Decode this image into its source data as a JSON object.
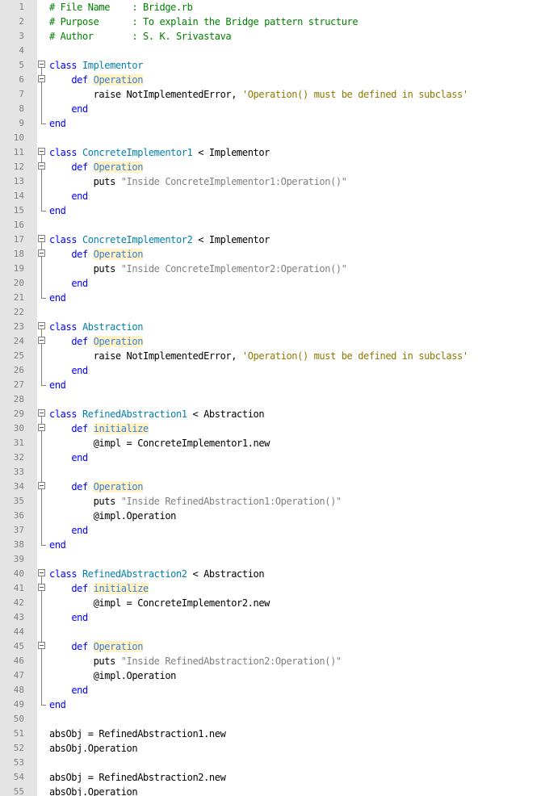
{
  "editor": {
    "lines": [
      {
        "n": "1",
        "fold": "",
        "tokens": [
          {
            "t": "# File Name    : Bridge.rb",
            "c": "comment"
          }
        ]
      },
      {
        "n": "2",
        "fold": "",
        "tokens": [
          {
            "t": "# Purpose      : To explain the Bridge pattern structure",
            "c": "comment"
          }
        ]
      },
      {
        "n": "3",
        "fold": "",
        "tokens": [
          {
            "t": "# Author       : S. K. Srivastava",
            "c": "comment"
          }
        ]
      },
      {
        "n": "4",
        "fold": "",
        "tokens": []
      },
      {
        "n": "5",
        "fold": "minus",
        "tokens": [
          {
            "t": "class",
            "c": "kw"
          },
          {
            "t": " "
          },
          {
            "t": "Implementor",
            "c": "cls"
          }
        ]
      },
      {
        "n": "6",
        "fold": "minus2",
        "tokens": [
          {
            "t": "    "
          },
          {
            "t": "def",
            "c": "kw"
          },
          {
            "t": " "
          },
          {
            "t": "Operation",
            "c": "fn"
          }
        ]
      },
      {
        "n": "7",
        "fold": "bar",
        "tokens": [
          {
            "t": "        raise NotImplementedError, "
          },
          {
            "t": "'Operation() must be defined in subclass'",
            "c": "sq"
          }
        ]
      },
      {
        "n": "8",
        "fold": "bar",
        "tokens": [
          {
            "t": "    "
          },
          {
            "t": "end",
            "c": "kw"
          }
        ]
      },
      {
        "n": "9",
        "fold": "end",
        "tokens": [
          {
            "t": "end",
            "c": "kw"
          }
        ]
      },
      {
        "n": "10",
        "fold": "",
        "tokens": []
      },
      {
        "n": "11",
        "fold": "minus",
        "tokens": [
          {
            "t": "class",
            "c": "kw"
          },
          {
            "t": " "
          },
          {
            "t": "ConcreteImplementor1",
            "c": "cls"
          },
          {
            "t": " < Implementor"
          }
        ]
      },
      {
        "n": "12",
        "fold": "minus2",
        "tokens": [
          {
            "t": "    "
          },
          {
            "t": "def",
            "c": "kw"
          },
          {
            "t": " "
          },
          {
            "t": "Operation",
            "c": "fn"
          }
        ]
      },
      {
        "n": "13",
        "fold": "bar",
        "tokens": [
          {
            "t": "        puts "
          },
          {
            "t": "\"Inside ConcreteImplementor1:Operation()\"",
            "c": "str"
          }
        ]
      },
      {
        "n": "14",
        "fold": "bar",
        "tokens": [
          {
            "t": "    "
          },
          {
            "t": "end",
            "c": "kw"
          }
        ]
      },
      {
        "n": "15",
        "fold": "end",
        "tokens": [
          {
            "t": "end",
            "c": "kw"
          }
        ]
      },
      {
        "n": "16",
        "fold": "",
        "tokens": []
      },
      {
        "n": "17",
        "fold": "minus",
        "tokens": [
          {
            "t": "class",
            "c": "kw"
          },
          {
            "t": " "
          },
          {
            "t": "ConcreteImplementor2",
            "c": "cls"
          },
          {
            "t": " < Implementor"
          }
        ]
      },
      {
        "n": "18",
        "fold": "minus2",
        "tokens": [
          {
            "t": "    "
          },
          {
            "t": "def",
            "c": "kw"
          },
          {
            "t": " "
          },
          {
            "t": "Operation",
            "c": "fn"
          }
        ]
      },
      {
        "n": "19",
        "fold": "bar",
        "tokens": [
          {
            "t": "        puts "
          },
          {
            "t": "\"Inside ConcreteImplementor2:Operation()\"",
            "c": "str"
          }
        ]
      },
      {
        "n": "20",
        "fold": "bar",
        "tokens": [
          {
            "t": "    "
          },
          {
            "t": "end",
            "c": "kw"
          }
        ]
      },
      {
        "n": "21",
        "fold": "end",
        "tokens": [
          {
            "t": "end",
            "c": "kw"
          }
        ]
      },
      {
        "n": "22",
        "fold": "",
        "tokens": []
      },
      {
        "n": "23",
        "fold": "minus",
        "tokens": [
          {
            "t": "class",
            "c": "kw"
          },
          {
            "t": " "
          },
          {
            "t": "Abstraction",
            "c": "cls"
          }
        ]
      },
      {
        "n": "24",
        "fold": "minus2",
        "tokens": [
          {
            "t": "    "
          },
          {
            "t": "def",
            "c": "kw"
          },
          {
            "t": " "
          },
          {
            "t": "Operation",
            "c": "fn"
          }
        ]
      },
      {
        "n": "25",
        "fold": "bar",
        "tokens": [
          {
            "t": "        raise NotImplementedError, "
          },
          {
            "t": "'Operation() must be defined in subclass'",
            "c": "sq"
          }
        ]
      },
      {
        "n": "26",
        "fold": "bar",
        "tokens": [
          {
            "t": "    "
          },
          {
            "t": "end",
            "c": "kw"
          }
        ]
      },
      {
        "n": "27",
        "fold": "end",
        "tokens": [
          {
            "t": "end",
            "c": "kw"
          }
        ]
      },
      {
        "n": "28",
        "fold": "",
        "tokens": []
      },
      {
        "n": "29",
        "fold": "minus",
        "tokens": [
          {
            "t": "class",
            "c": "kw"
          },
          {
            "t": " "
          },
          {
            "t": "RefinedAbstraction1",
            "c": "cls"
          },
          {
            "t": " < Abstraction"
          }
        ]
      },
      {
        "n": "30",
        "fold": "minus2",
        "tokens": [
          {
            "t": "    "
          },
          {
            "t": "def",
            "c": "kw"
          },
          {
            "t": " "
          },
          {
            "t": "initialize",
            "c": "fn"
          }
        ]
      },
      {
        "n": "31",
        "fold": "bar",
        "tokens": [
          {
            "t": "        @impl = ConcreteImplementor1.new"
          }
        ]
      },
      {
        "n": "32",
        "fold": "bar",
        "tokens": [
          {
            "t": "    "
          },
          {
            "t": "end",
            "c": "kw"
          }
        ]
      },
      {
        "n": "33",
        "fold": "bar",
        "tokens": []
      },
      {
        "n": "34",
        "fold": "minus2",
        "tokens": [
          {
            "t": "    "
          },
          {
            "t": "def",
            "c": "kw"
          },
          {
            "t": " "
          },
          {
            "t": "Operation",
            "c": "fn"
          }
        ]
      },
      {
        "n": "35",
        "fold": "bar",
        "tokens": [
          {
            "t": "        puts "
          },
          {
            "t": "\"Inside RefinedAbstraction1:Operation()\"",
            "c": "str"
          }
        ]
      },
      {
        "n": "36",
        "fold": "bar",
        "tokens": [
          {
            "t": "        @impl.Operation"
          }
        ]
      },
      {
        "n": "37",
        "fold": "bar",
        "tokens": [
          {
            "t": "    "
          },
          {
            "t": "end",
            "c": "kw"
          }
        ]
      },
      {
        "n": "38",
        "fold": "end",
        "tokens": [
          {
            "t": "end",
            "c": "kw"
          }
        ]
      },
      {
        "n": "39",
        "fold": "",
        "tokens": []
      },
      {
        "n": "40",
        "fold": "minus",
        "tokens": [
          {
            "t": "class",
            "c": "kw"
          },
          {
            "t": " "
          },
          {
            "t": "RefinedAbstraction2",
            "c": "cls"
          },
          {
            "t": " < Abstraction"
          }
        ]
      },
      {
        "n": "41",
        "fold": "minus2",
        "tokens": [
          {
            "t": "    "
          },
          {
            "t": "def",
            "c": "kw"
          },
          {
            "t": " "
          },
          {
            "t": "initialize",
            "c": "fn"
          }
        ]
      },
      {
        "n": "42",
        "fold": "bar",
        "tokens": [
          {
            "t": "        @impl = ConcreteImplementor2.new"
          }
        ]
      },
      {
        "n": "43",
        "fold": "bar",
        "tokens": [
          {
            "t": "    "
          },
          {
            "t": "end",
            "c": "kw"
          }
        ]
      },
      {
        "n": "44",
        "fold": "bar",
        "tokens": []
      },
      {
        "n": "45",
        "fold": "minus2",
        "tokens": [
          {
            "t": "    "
          },
          {
            "t": "def",
            "c": "kw"
          },
          {
            "t": " "
          },
          {
            "t": "Operation",
            "c": "fn"
          }
        ]
      },
      {
        "n": "46",
        "fold": "bar",
        "tokens": [
          {
            "t": "        puts "
          },
          {
            "t": "\"Inside RefinedAbstraction2:Operation()\"",
            "c": "str"
          }
        ]
      },
      {
        "n": "47",
        "fold": "bar",
        "tokens": [
          {
            "t": "        @impl.Operation"
          }
        ]
      },
      {
        "n": "48",
        "fold": "bar",
        "tokens": [
          {
            "t": "    "
          },
          {
            "t": "end",
            "c": "kw"
          }
        ]
      },
      {
        "n": "49",
        "fold": "end",
        "tokens": [
          {
            "t": "end",
            "c": "kw"
          }
        ]
      },
      {
        "n": "50",
        "fold": "",
        "tokens": []
      },
      {
        "n": "51",
        "fold": "",
        "tokens": [
          {
            "t": "absObj = RefinedAbstraction1.new"
          }
        ]
      },
      {
        "n": "52",
        "fold": "",
        "tokens": [
          {
            "t": "absObj.Operation"
          }
        ]
      },
      {
        "n": "53",
        "fold": "",
        "tokens": []
      },
      {
        "n": "54",
        "fold": "",
        "tokens": [
          {
            "t": "absObj = RefinedAbstraction2.new"
          }
        ]
      },
      {
        "n": "55",
        "fold": "",
        "tokens": [
          {
            "t": "absObj.Operation"
          }
        ]
      }
    ]
  }
}
